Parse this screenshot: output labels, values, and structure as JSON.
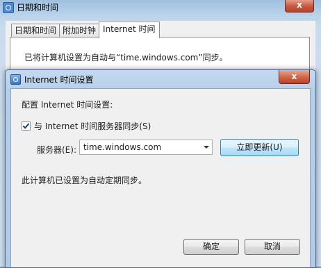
{
  "background_window": {
    "title": "日期和时间",
    "close_label": "x",
    "tabs": [
      {
        "label": "日期和时间"
      },
      {
        "label": "附加时钟"
      },
      {
        "label": "Internet 时间"
      }
    ],
    "sync_text": "已将计算机设置为自动与“time.windows.com”同步。"
  },
  "dialog": {
    "title": "Internet 时间设置",
    "close_label": "x",
    "config_label": "配置 Internet 时间设置:",
    "sync_checkbox": {
      "label": "与 Internet 时间服务器同步(S)",
      "checked": true
    },
    "server_label": "服务器(E):",
    "server_value": "time.windows.com",
    "update_button": "立即更新(U)",
    "auto_sync_text": "此计算机已设置为自动定期同步。",
    "ok_button": "确定",
    "cancel_button": "取消"
  }
}
